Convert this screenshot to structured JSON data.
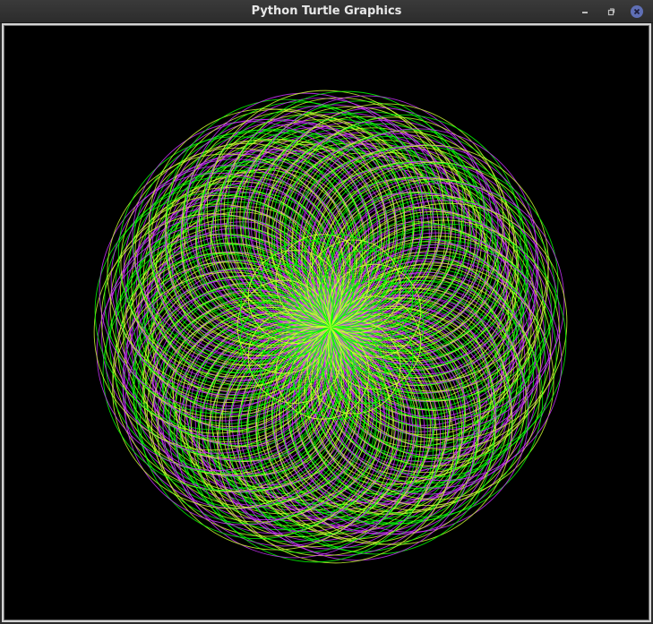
{
  "window": {
    "title": "Python Turtle Graphics"
  },
  "controls": {
    "minimize_icon": "minimize-icon",
    "restore_icon": "restore-icon",
    "close_icon": "close-icon"
  },
  "canvas": {
    "background": "#000000",
    "pen_colors": [
      "#00ff00",
      "#cc33ff",
      "#ccff33"
    ],
    "petals": 9,
    "drawing": "spirograph-of-circles"
  }
}
